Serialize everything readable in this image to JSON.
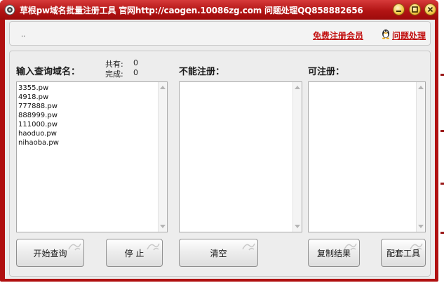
{
  "window": {
    "title": "草根pw域名批量注册工具  官网http://caogen.10086zg.com 问题处理QQ858882656",
    "controls": [
      "minimize",
      "maximize",
      "close"
    ]
  },
  "topbar": {
    "status_text": "..",
    "register_link": "免费注册会员",
    "help_link": "问题处理"
  },
  "panels": {
    "query": {
      "label": "输入查询域名：",
      "total_label": "共有:",
      "total_value": "0",
      "done_label": "完成:",
      "done_value": "0",
      "lines": [
        "3355.pw",
        "4918.pw",
        "777888.pw",
        "888999.pw",
        "111000.pw",
        "haoduo.pw",
        "nihaoba.pw"
      ]
    },
    "unavailable": {
      "label": "不能注册：",
      "lines": []
    },
    "available": {
      "label": "可注册：",
      "lines": []
    }
  },
  "buttons": {
    "start": "开始查询",
    "stop": "停 止",
    "clear": "清空",
    "copy": "复制结果",
    "config": "配套工具"
  },
  "colors": {
    "titlebar": "#b21414",
    "link": "#c21010",
    "window_bg": "#ececec"
  },
  "icons": {
    "app": "app-logo-icon",
    "help": "qq-penguin-icon"
  }
}
